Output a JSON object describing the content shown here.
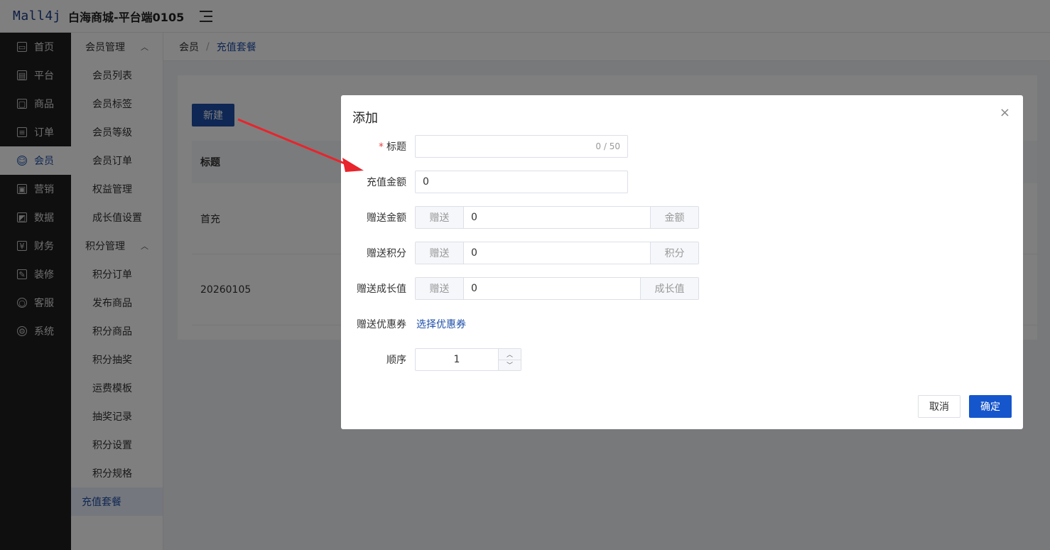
{
  "header": {
    "logo": "Mall4j",
    "shop_name": "白海商城-平台端0105"
  },
  "sidebar": {
    "items": [
      {
        "label": "首页",
        "icon": "monitor-icon",
        "glyph": "▭"
      },
      {
        "label": "平台",
        "icon": "platform-icon",
        "glyph": "▤"
      },
      {
        "label": "商品",
        "icon": "goods-icon",
        "glyph": "▢"
      },
      {
        "label": "订单",
        "icon": "order-icon",
        "glyph": "≡"
      },
      {
        "label": "会员",
        "icon": "member-icon",
        "glyph": "☺",
        "active": true
      },
      {
        "label": "营销",
        "icon": "gift-icon",
        "glyph": "▣"
      },
      {
        "label": "数据",
        "icon": "chart-icon",
        "glyph": "◩"
      },
      {
        "label": "财务",
        "icon": "finance-icon",
        "glyph": "¥"
      },
      {
        "label": "装修",
        "icon": "decorate-icon",
        "glyph": "✎"
      },
      {
        "label": "客服",
        "icon": "chat-icon",
        "glyph": "○"
      },
      {
        "label": "系统",
        "icon": "gear-icon",
        "glyph": "⚙"
      }
    ]
  },
  "subnav": {
    "group1": "会员管理",
    "group1_items": [
      "会员列表",
      "会员标签",
      "会员等级",
      "会员订单",
      "权益管理",
      "成长值设置"
    ],
    "group2": "积分管理",
    "group2_items": [
      "积分订单",
      "发布商品",
      "积分商品",
      "积分抽奖",
      "运费模板",
      "抽奖记录",
      "积分设置",
      "积分规格"
    ],
    "active_item": "充值套餐"
  },
  "breadcrumb": {
    "parent": "会员",
    "separator": "/",
    "current": "充值套餐"
  },
  "content": {
    "new_button": "新建",
    "table_header": "标题",
    "rows": [
      "首充",
      "20260105"
    ]
  },
  "dialog": {
    "title": "添加",
    "close": "×",
    "required_mark": "*",
    "title_label": "标题",
    "title_counter": "0 / 50",
    "amount_label": "充值金额",
    "amount_value": "0",
    "bonus_amount_label": "赠送金额",
    "bonus_prefix": "赠送",
    "bonus_amount_value": "0",
    "bonus_amount_suffix": "金额",
    "bonus_points_label": "赠送积分",
    "bonus_points_value": "0",
    "bonus_points_suffix": "积分",
    "bonus_growth_label": "赠送成长值",
    "bonus_growth_value": "0",
    "bonus_growth_suffix": "成长值",
    "coupon_label": "赠送优惠券",
    "coupon_link": "选择优惠券",
    "order_label": "顺序",
    "order_value": "1",
    "cancel": "取消",
    "confirm": "确定"
  },
  "colors": {
    "brand": "#1e4fa8",
    "primary_button": "#1656cc",
    "annotation_arrow": "#e8242c"
  }
}
